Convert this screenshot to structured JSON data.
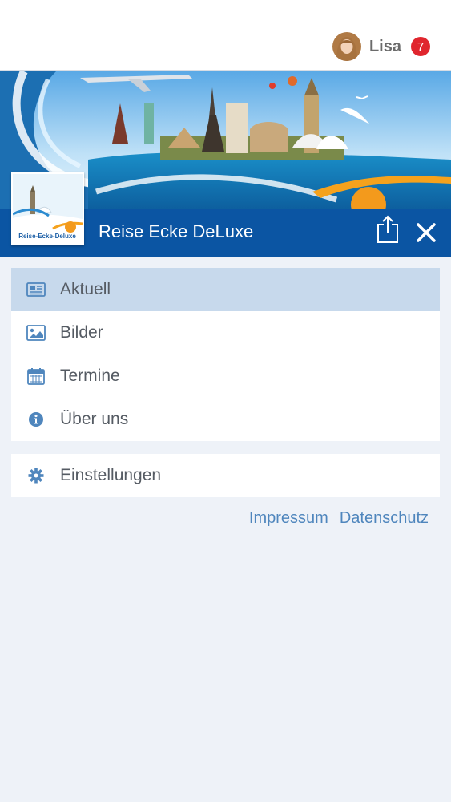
{
  "user": {
    "name": "Lisa",
    "notification_count": "7"
  },
  "header": {
    "title": "Reise Ecke DeLuxe",
    "logo_text": "Reise-Ecke-Deluxe"
  },
  "menu_main": [
    {
      "label": "Aktuell",
      "icon": "newspaper-icon",
      "active": true
    },
    {
      "label": "Bilder",
      "icon": "image-icon",
      "active": false
    },
    {
      "label": "Termine",
      "icon": "calendar-icon",
      "active": false
    },
    {
      "label": "Über uns",
      "icon": "info-icon",
      "active": false
    }
  ],
  "menu_secondary": [
    {
      "label": "Einstellungen",
      "icon": "gear-icon"
    }
  ],
  "footer": {
    "impressum": "Impressum",
    "datenschutz": "Datenschutz"
  },
  "colors": {
    "brand_blue": "#0b55a3",
    "active_row": "#c7d9ec",
    "icon_blue": "#4f86bd",
    "badge_red": "#e0262e"
  }
}
